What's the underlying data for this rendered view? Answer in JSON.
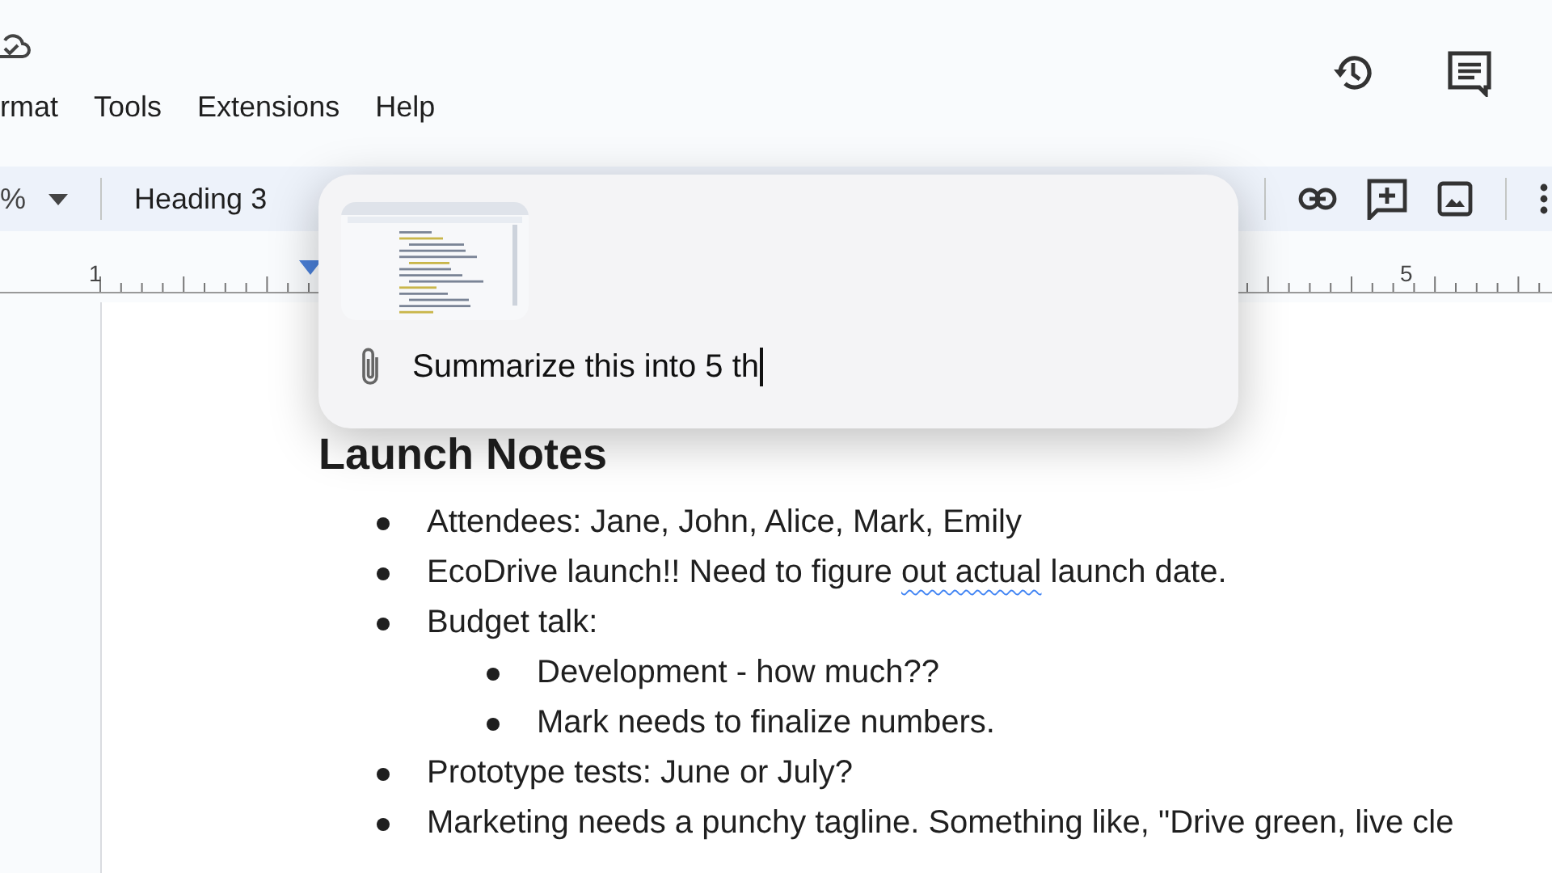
{
  "menu": [
    {
      "label": "rmat"
    },
    {
      "label": "Tools"
    },
    {
      "label": "Extensions"
    },
    {
      "label": "Help"
    }
  ],
  "toolbar": {
    "zoom": "%",
    "style": "Heading 3"
  },
  "ruler": {
    "labels": [
      "1",
      "5"
    ]
  },
  "document": {
    "heading": "Launch Notes",
    "items": [
      {
        "parts": [
          {
            "text": "Attendees: Jane, John, Alice, Mark, Emily",
            "flagged": false
          }
        ]
      },
      {
        "parts": [
          {
            "text": "EcoDrive launch!! Need to figure ",
            "flagged": false
          },
          {
            "text": "out actual",
            "flagged": true
          },
          {
            "text": " launch date.",
            "flagged": false
          }
        ]
      },
      {
        "parts": [
          {
            "text": "Budget talk:",
            "flagged": false
          }
        ],
        "children": [
          {
            "parts": [
              {
                "text": "Development - how much??",
                "flagged": false
              }
            ]
          },
          {
            "parts": [
              {
                "text": "Mark needs to finalize numbers.",
                "flagged": false
              }
            ]
          }
        ]
      },
      {
        "parts": [
          {
            "text": "Prototype tests: June or July?",
            "flagged": false
          }
        ]
      },
      {
        "parts": [
          {
            "text": "Marketing needs a punchy tagline. Something like, \"Drive green, live cle",
            "flagged": false
          }
        ]
      }
    ]
  },
  "prompt": {
    "attachments": [
      {
        "kind": "screenshot"
      }
    ],
    "value": "Summarize this into 5 th",
    "focused": true
  }
}
